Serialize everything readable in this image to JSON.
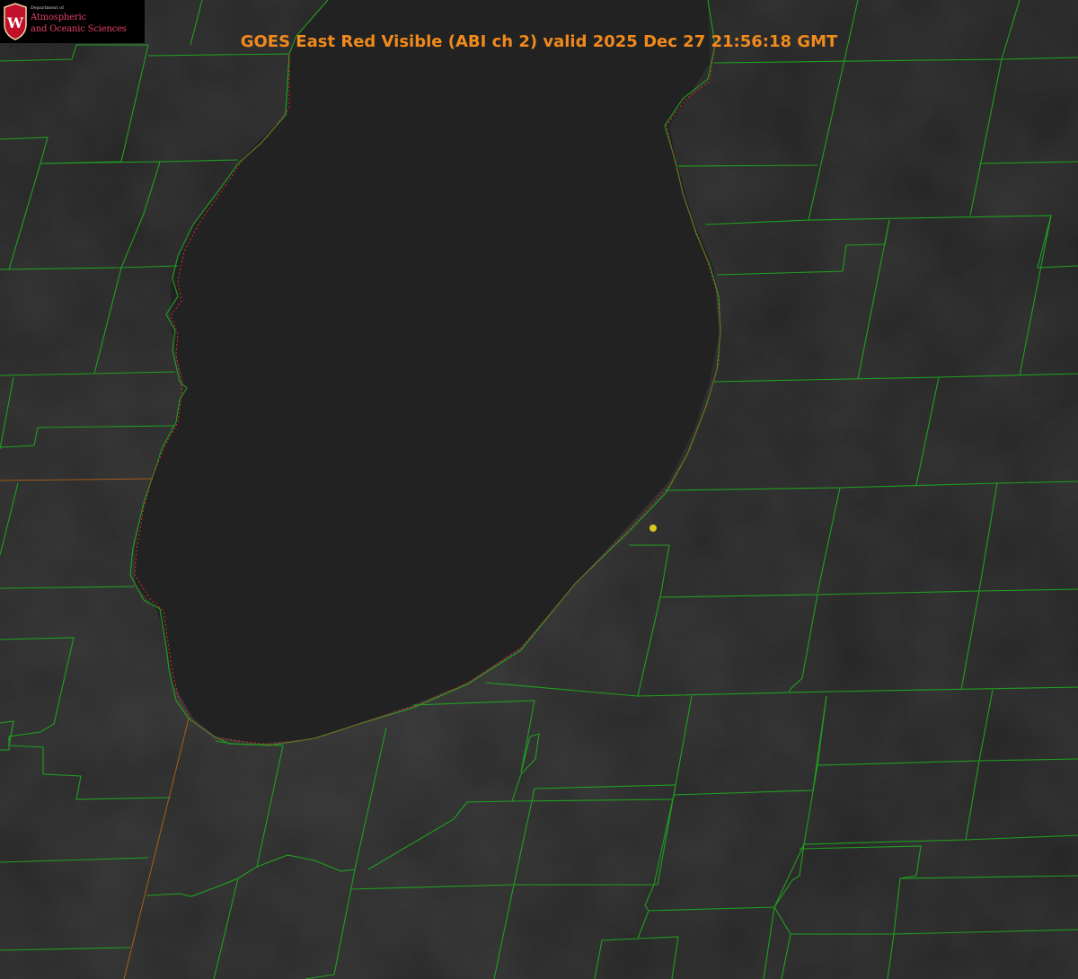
{
  "title": "GOES East Red Visible (ABI ch 2) valid 2025 Dec 27 21:56:18 GMT",
  "logo": {
    "department_label": "Department of",
    "line1": "Atmospheric",
    "line2": "and Oceanic Sciences",
    "shield_letter": "W"
  },
  "colors": {
    "background": "#262626",
    "boundaries": "#1fa01f",
    "state_line": "#a05a1c",
    "shoreline": "#e0282a",
    "marker": "#d6c81e",
    "title": "#f08a1c",
    "logo_text": "#e0406a"
  },
  "icons": {
    "logo_shield": "university-crest-icon",
    "marker": "point-marker-icon"
  }
}
